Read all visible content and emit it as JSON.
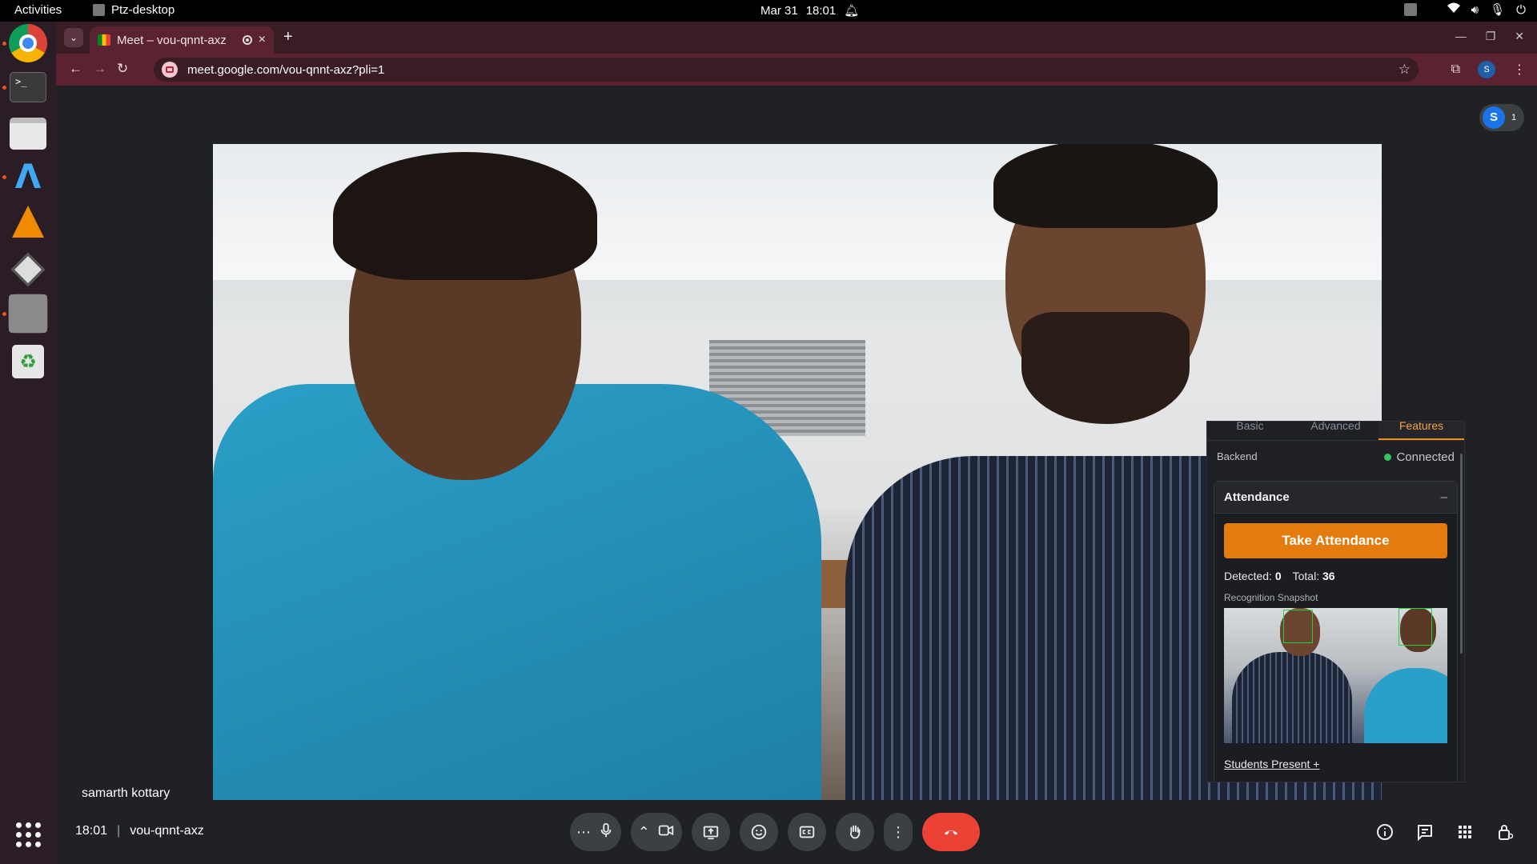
{
  "system": {
    "activities": "Activities",
    "app_name": "Ptz-desktop",
    "date": "Mar 31",
    "time": "18:01"
  },
  "browser": {
    "tab_title": "Meet – vou-qnnt-axz",
    "url": "meet.google.com/vou-qnnt-axz?pli=1",
    "profile_initial": "S"
  },
  "meet": {
    "participant_initial": "S",
    "participant_count": "1",
    "speaker_name": "samarth kottary",
    "clock": "18:01",
    "meeting_code": "vou-qnnt-axz"
  },
  "panel": {
    "tabs": [
      "Basic",
      "Advanced",
      "Features"
    ],
    "active_tab": "Features",
    "backend_label": "Backend",
    "backend_status": "Connected",
    "status_color": "#34c759",
    "section_title": "Attendance",
    "collapse_symbol": "–",
    "take_button": "Take Attendance",
    "detected_label": "Detected:",
    "detected_value": "0",
    "total_label": "Total:",
    "total_value": "36",
    "snapshot_label": "Recognition Snapshot",
    "students_link": "Students Present +"
  },
  "colors": {
    "accent_orange": "#e37b0e",
    "end_call_red": "#ea4335",
    "meet_bg": "#202124"
  },
  "icons": {
    "dock": [
      "chrome-icon",
      "terminal-icon",
      "files-icon",
      "arc-icon",
      "vlc-icon",
      "package-icon",
      "window-icon",
      "trash-icon",
      "show-apps-icon"
    ],
    "controls": [
      "more-options-icon",
      "microphone-icon",
      "chevron-up-icon",
      "camera-icon",
      "present-icon",
      "emoji-icon",
      "captions-icon",
      "raise-hand-icon",
      "more-vert-icon",
      "end-call-icon"
    ],
    "right_tools": [
      "info-icon",
      "chat-icon",
      "activities-icon",
      "host-controls-icon"
    ]
  }
}
